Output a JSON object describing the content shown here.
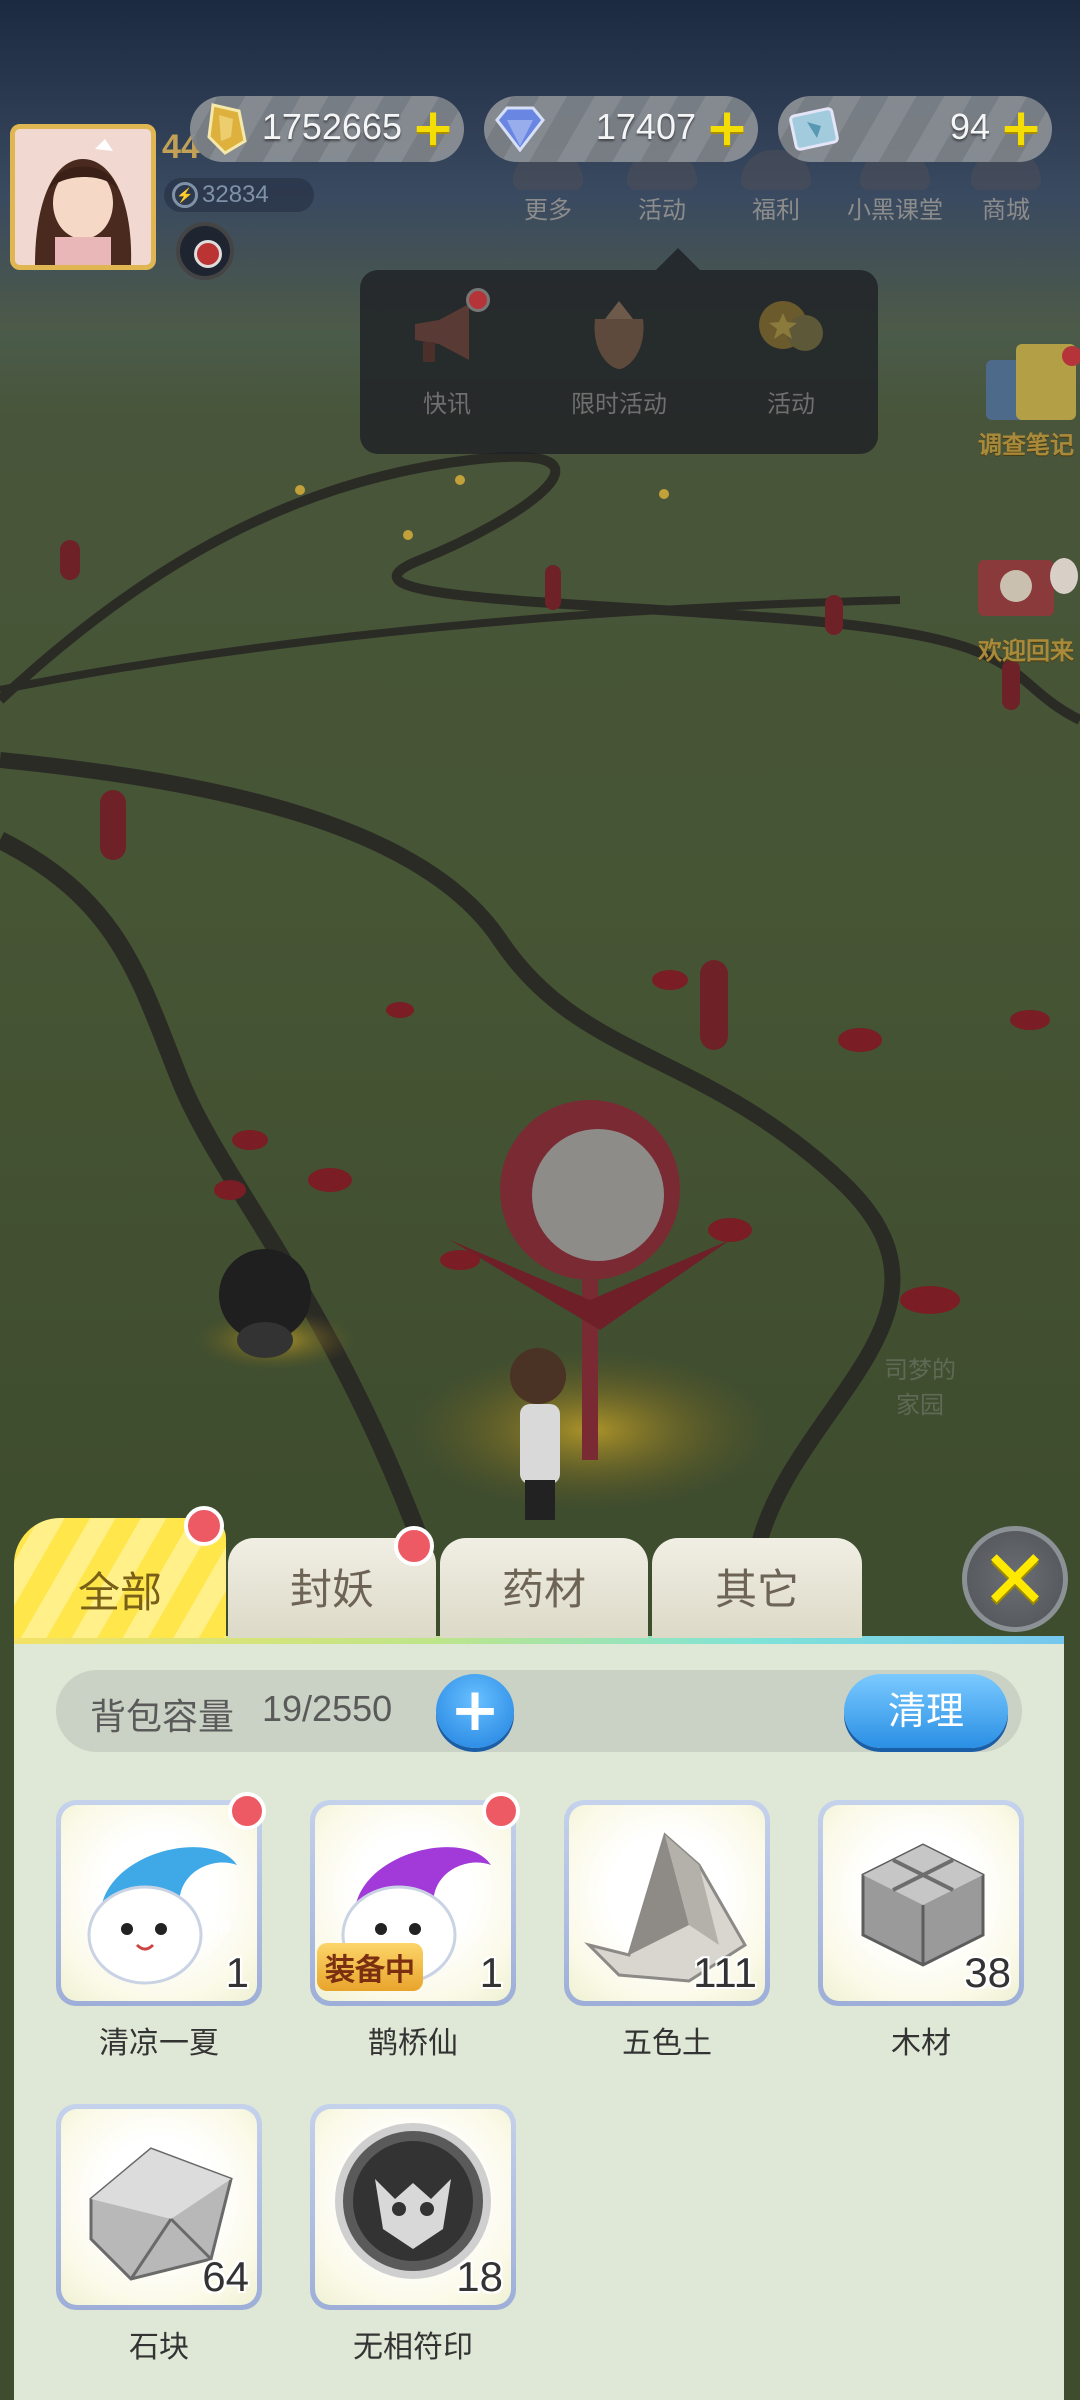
{
  "currencies": [
    {
      "name": "gold-icon",
      "value": "1752665",
      "plus": "+"
    },
    {
      "name": "diamond-icon",
      "value": "17407",
      "plus": "+"
    },
    {
      "name": "ticket-icon",
      "value": "94",
      "plus": "+"
    }
  ],
  "player": {
    "level": "44",
    "power": "32834"
  },
  "top_menu": [
    "更多",
    "活动",
    "福利",
    "小黑课堂",
    "商城"
  ],
  "popup_items": [
    "快讯",
    "限时活动",
    "活动"
  ],
  "side_banners": [
    "调查笔记",
    "欢迎回来"
  ],
  "scene_text": "司梦的\n家园",
  "tabs": [
    {
      "label": "全部",
      "active": true,
      "badge": true
    },
    {
      "label": "封妖",
      "active": false,
      "badge": true
    },
    {
      "label": "药材",
      "active": false,
      "badge": false
    },
    {
      "label": "其它",
      "active": false,
      "badge": false
    }
  ],
  "close_label": "✕",
  "capacity": {
    "label": "背包容量",
    "value": "19/2550",
    "add": "+",
    "clean": "清理"
  },
  "items": [
    {
      "name": "清凉一夏",
      "count": "1",
      "badge": true,
      "equipped": false,
      "icon": "spirit-blue-icon"
    },
    {
      "name": "鹊桥仙",
      "count": "1",
      "badge": true,
      "equipped": true,
      "equipped_label": "装备中",
      "icon": "spirit-purple-icon"
    },
    {
      "name": "五色土",
      "count": "111",
      "badge": false,
      "equipped": false,
      "icon": "soil-icon"
    },
    {
      "name": "木材",
      "count": "38",
      "badge": false,
      "equipped": false,
      "icon": "wood-icon"
    },
    {
      "name": "石块",
      "count": "64",
      "badge": false,
      "equipped": false,
      "icon": "stone-icon"
    },
    {
      "name": "无相符印",
      "count": "18",
      "badge": false,
      "equipped": false,
      "icon": "seal-icon"
    }
  ],
  "colors": {
    "accent_blue": "#2a8fe4",
    "badge_red": "#ee5a64",
    "tab_active": "#ffe74b"
  }
}
